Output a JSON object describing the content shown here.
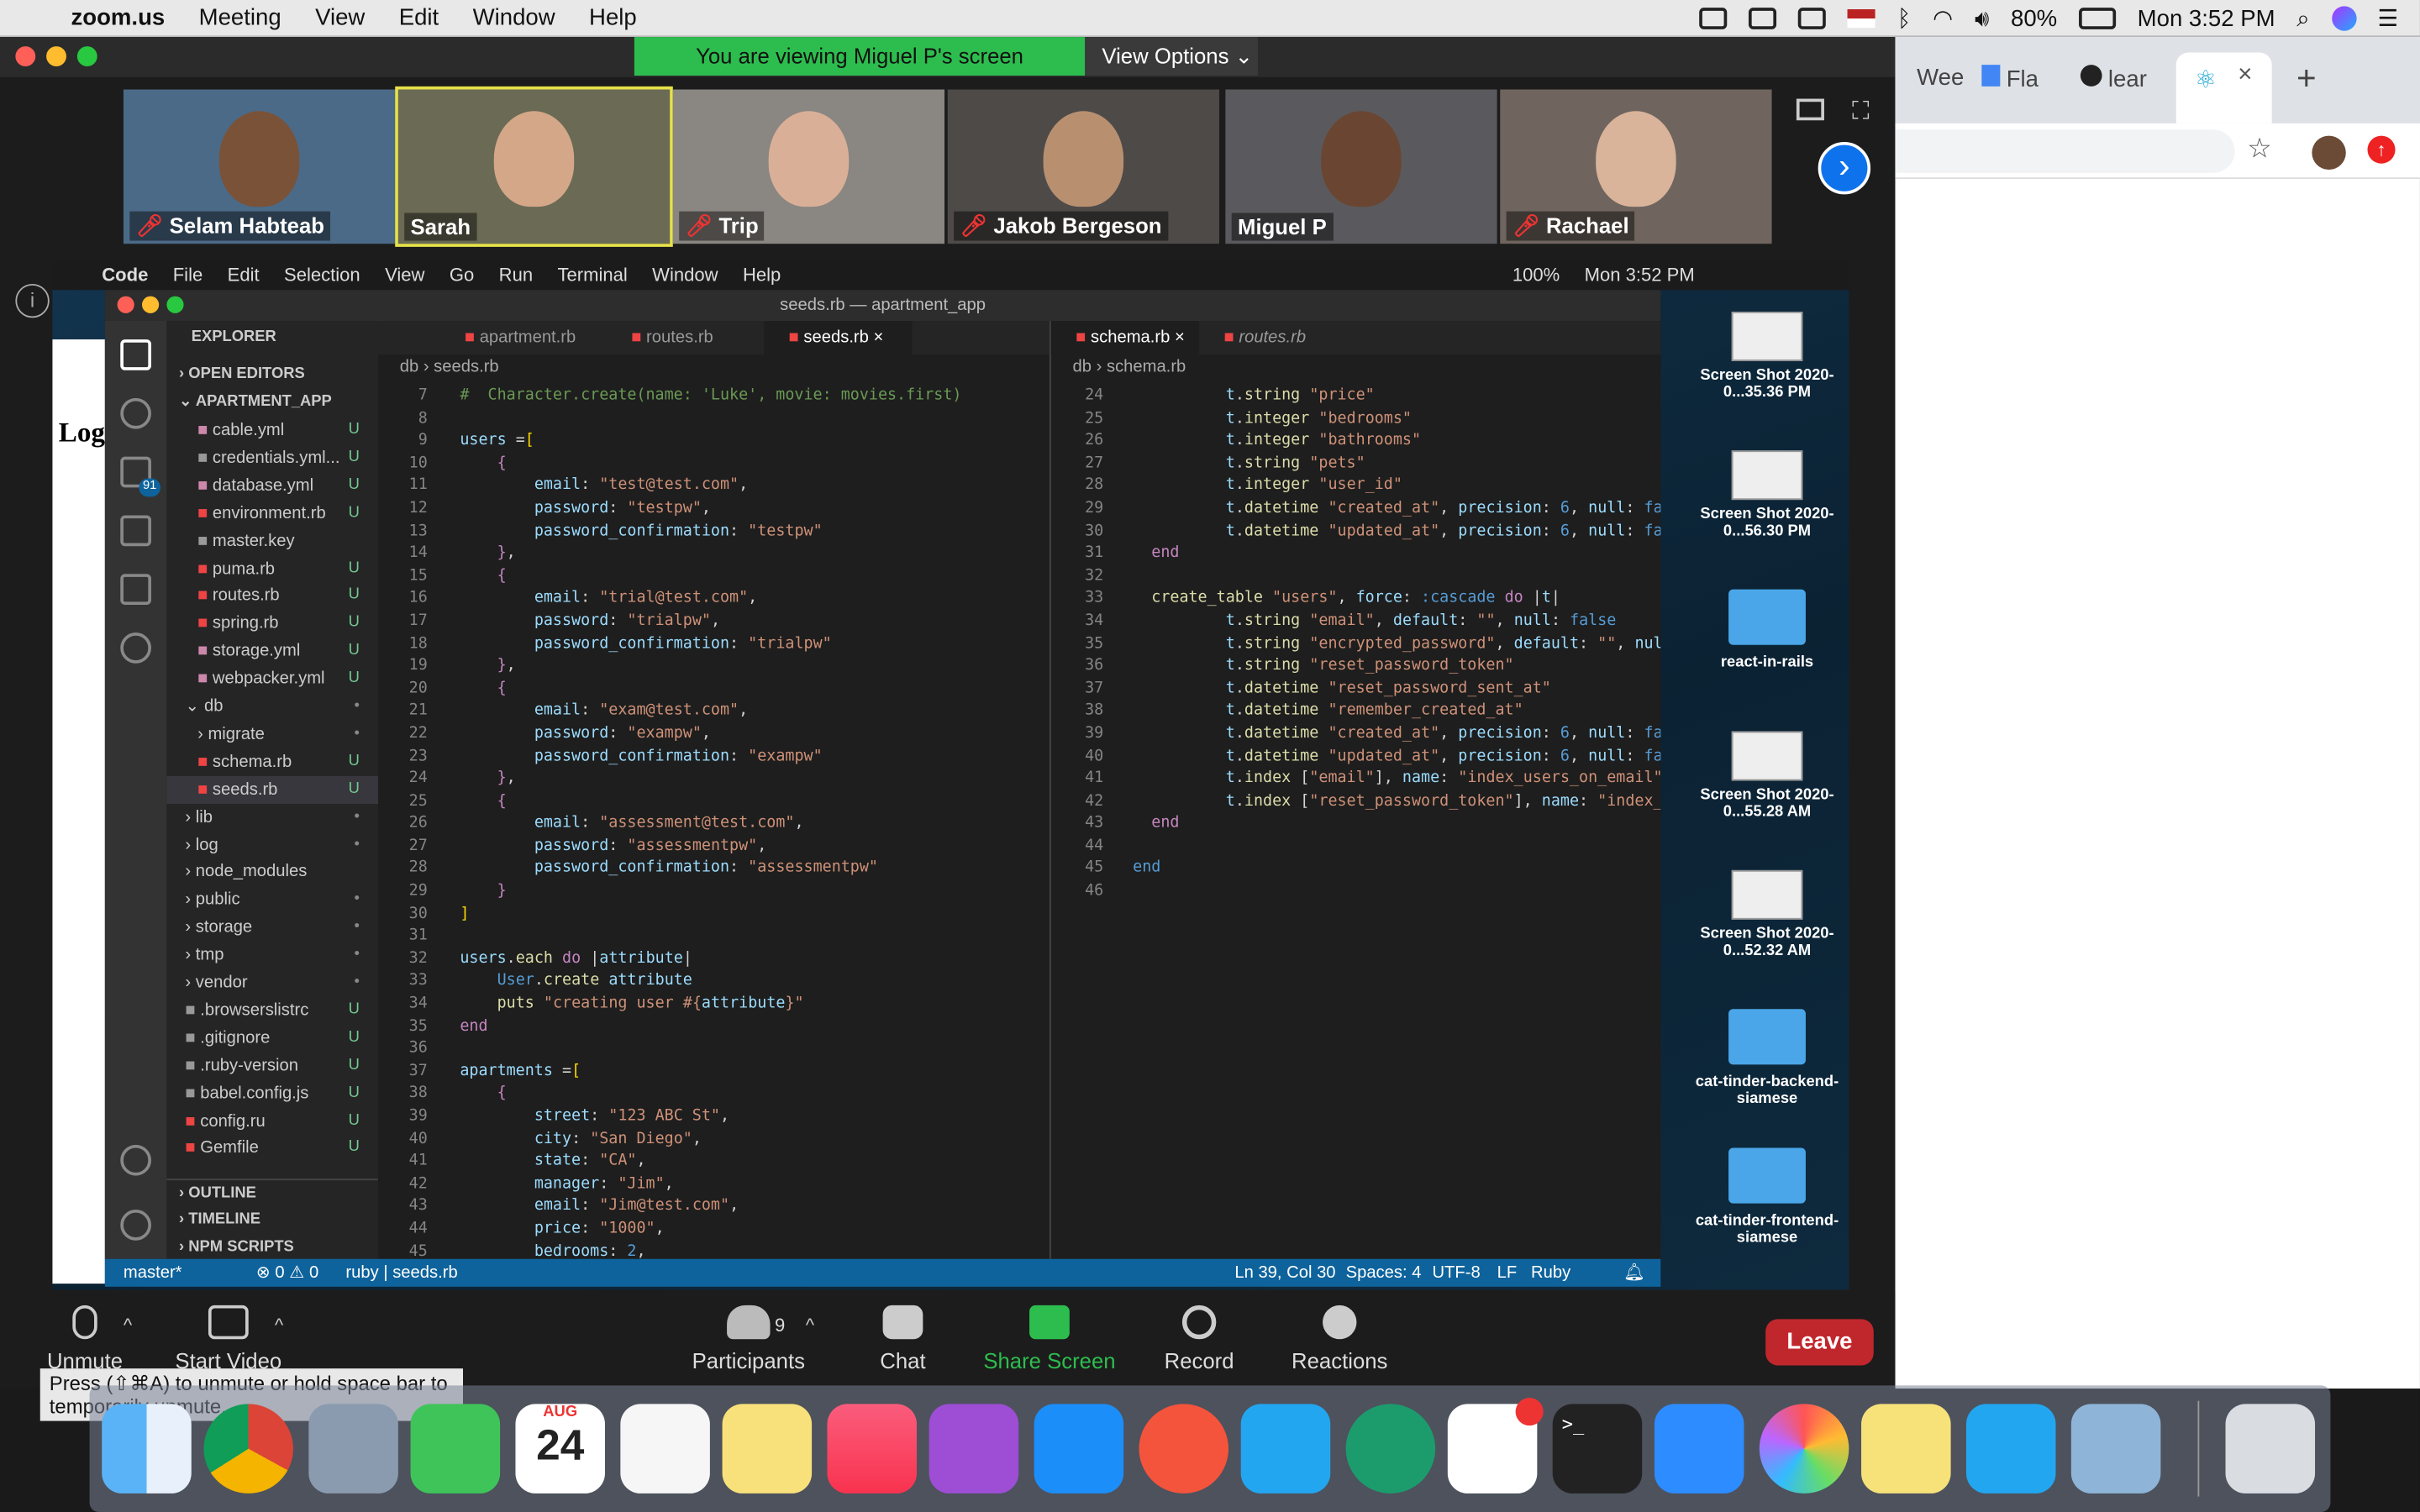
{
  "menubar": {
    "app": "zoom.us",
    "items": [
      "Meeting",
      "View",
      "Edit",
      "Window",
      "Help"
    ],
    "battery": "80%",
    "clock": "Mon 3:52 PM"
  },
  "zoom": {
    "banner": "You are viewing Miguel P's screen",
    "view_options": "View Options",
    "participants": [
      {
        "name": "Selam Habteab",
        "muted": true
      },
      {
        "name": "Sarah",
        "muted": false
      },
      {
        "name": "Trip",
        "muted": true
      },
      {
        "name": "Jakob Bergeson",
        "muted": true
      },
      {
        "name": "Miguel P",
        "muted": false
      },
      {
        "name": "Rachael",
        "muted": true
      }
    ],
    "toolbar": {
      "unmute": "Unmute",
      "start_video": "Start Video",
      "participants": "Participants",
      "participants_count": "9",
      "chat": "Chat",
      "share_screen": "Share Screen",
      "record": "Record",
      "reactions": "Reactions",
      "leave": "Leave"
    },
    "tooltip": "Press (⇧⌘A) to unmute or hold space bar to temporarily unmute."
  },
  "remote_menubar": {
    "app": "Code",
    "items": [
      "File",
      "Edit",
      "Selection",
      "View",
      "Go",
      "Run",
      "Terminal",
      "Window",
      "Help"
    ],
    "battery": "100%",
    "clock": "Mon 3:52 PM"
  },
  "vscode": {
    "title": "seeds.rb — apartment_app",
    "explorer_title": "EXPLORER",
    "open_editors": "OPEN EDITORS",
    "project": "APARTMENT_APP",
    "files": [
      {
        "name": "cable.yml",
        "st": "U"
      },
      {
        "name": "credentials.yml...",
        "st": "U"
      },
      {
        "name": "database.yml",
        "st": "U"
      },
      {
        "name": "environment.rb",
        "st": "U"
      },
      {
        "name": "master.key",
        "st": ""
      },
      {
        "name": "puma.rb",
        "st": "U"
      },
      {
        "name": "routes.rb",
        "st": "U"
      },
      {
        "name": "spring.rb",
        "st": "U"
      },
      {
        "name": "storage.yml",
        "st": "U"
      },
      {
        "name": "webpacker.yml",
        "st": "U"
      },
      {
        "name": "db",
        "st": "•"
      },
      {
        "name": "migrate",
        "st": "•"
      },
      {
        "name": "schema.rb",
        "st": "U"
      },
      {
        "name": "seeds.rb",
        "st": "U"
      },
      {
        "name": "lib",
        "st": "•"
      },
      {
        "name": "log",
        "st": "•"
      },
      {
        "name": "node_modules",
        "st": ""
      },
      {
        "name": "public",
        "st": "•"
      },
      {
        "name": "storage",
        "st": "•"
      },
      {
        "name": "tmp",
        "st": "•"
      },
      {
        "name": "vendor",
        "st": "•"
      },
      {
        "name": ".browserslistrc",
        "st": "U"
      },
      {
        "name": ".gitignore",
        "st": "U"
      },
      {
        "name": ".ruby-version",
        "st": "U"
      },
      {
        "name": "babel.config.js",
        "st": "U"
      },
      {
        "name": "config.ru",
        "st": "U"
      },
      {
        "name": "Gemfile",
        "st": "U"
      }
    ],
    "outline": "OUTLINE",
    "timeline": "TIMELINE",
    "npm": "NPM SCRIPTS",
    "left_tabs": [
      "apartment.rb",
      "routes.rb",
      "seeds.rb"
    ],
    "right_tabs": [
      "schema.rb",
      "routes.rb"
    ],
    "left_crumb": [
      "db",
      "seeds.rb"
    ],
    "right_crumb": [
      "db",
      "schema.rb"
    ],
    "status": {
      "branch": "master*",
      "errors": "⊗ 0 ⚠ 0",
      "lang_env": "ruby | seeds.rb",
      "position": "Ln 39, Col 30",
      "spaces": "Spaces: 4",
      "encoding": "UTF-8",
      "eol": "LF",
      "language": "Ruby"
    }
  },
  "desktop": [
    {
      "label": "Screen Shot 2020-0...35.36 PM",
      "kind": "shot"
    },
    {
      "label": "Screen Shot 2020-0...56.30 PM",
      "kind": "shot"
    },
    {
      "label": "react-in-rails",
      "kind": "folder"
    },
    {
      "label": "Screen Shot 2020-0...55.28 AM",
      "kind": "shot"
    },
    {
      "label": "Screen Shot 2020-0...52.32 AM",
      "kind": "shot"
    },
    {
      "label": "cat-tinder-backend-siamese",
      "kind": "folder"
    },
    {
      "label": "cat-tinder-frontend-siamese",
      "kind": "folder"
    }
  ],
  "chrome_tabs": [
    "Wee",
    "Fla",
    "lear"
  ],
  "dock_calendar": {
    "month": "AUG",
    "day": "24"
  }
}
